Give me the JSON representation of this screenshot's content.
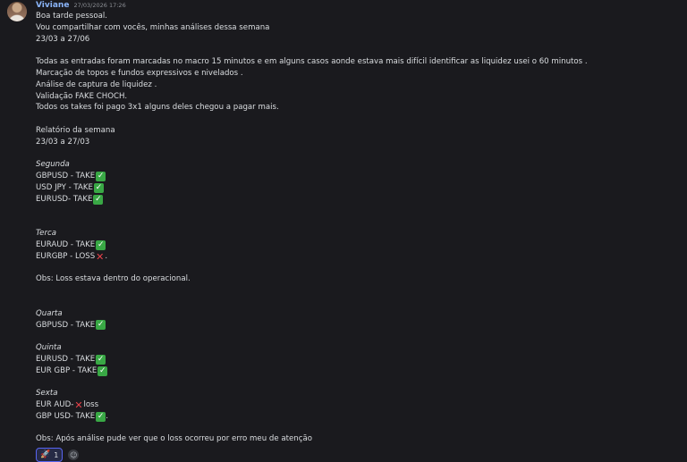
{
  "message": {
    "username": "Viviane",
    "timestamp": "27/03/2026 17:26",
    "lines": {
      "l1": "Boa tarde pessoal.",
      "l2": "Vou compartilhar com vocês, minhas análises dessa semana",
      "l3": "23/03 a 27/06",
      "l5": "Todas as entradas foram marcadas no macro 15 minutos e em alguns casos aonde estava mais difícil identificar as liquidez usei o 60 minutos .",
      "l6": "Marcação de topos e fundos expressivos e nivelados .",
      "l7": "Análise de captura de liquidez .",
      "l8": "Validação FAKE CHOCH.",
      "l9": "Todos os takes foi pago 3x1 alguns deles chegou a pagar mais.",
      "l11": "Relatório da semana",
      "l12": "23/03 a 27/03",
      "segunda": "Segunda",
      "seg1": "GBPUSD - TAKE",
      "seg2": "USD JPY - TAKE",
      "seg3": "EURUSD- TAKE",
      "terca": "Terca",
      "ter1": "EURAUD - TAKE",
      "ter2": "EURGBP - LOSS",
      "ter2_end": ".",
      "obs1": "Obs: Loss estava dentro do operacional.",
      "quarta": "Quarta",
      "qua1": "GBPUSD - TAKE",
      "quinta": "Quinta",
      "qui1": "EURUSD - TAKE",
      "qui2": "EUR GBP - TAKE",
      "sexta": "Sexta",
      "sex1": "EUR AUD- ",
      "sex1_end": "loss",
      "sex2": "GBP USD- TAKE",
      "sex2_end": ".",
      "obs2": "Obs: Após análise pude ver que o loss ocorreu por erro meu de atenção"
    },
    "icons": {
      "check": "✓",
      "cross": "✕",
      "rocket": "🚀",
      "add": "☺"
    },
    "reaction_count": "1",
    "colors": {
      "username": "#8ab4f8",
      "check_bg": "#39a845",
      "cross": "#e8424a",
      "reaction_border": "#5865f2"
    }
  }
}
